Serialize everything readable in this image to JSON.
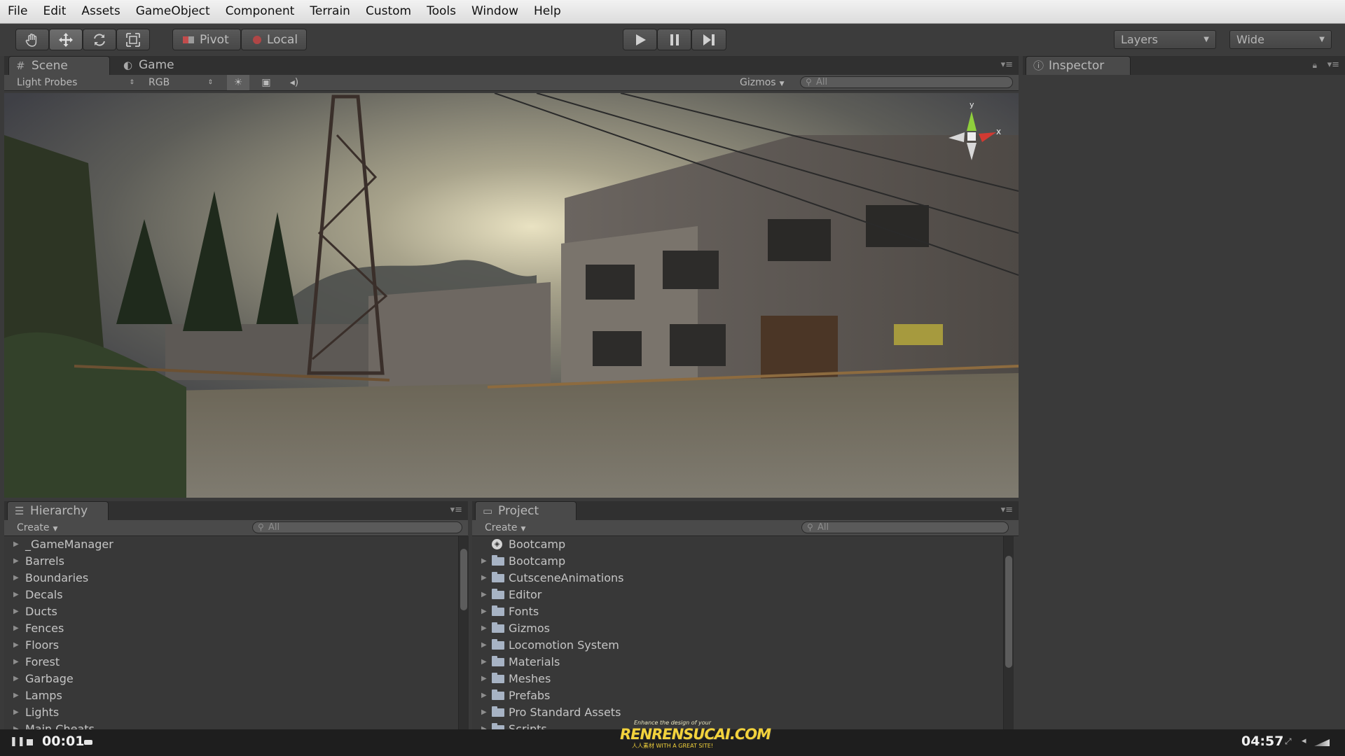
{
  "menu": [
    "File",
    "Edit",
    "Assets",
    "GameObject",
    "Component",
    "Terrain",
    "Custom",
    "Tools",
    "Window",
    "Help"
  ],
  "toolbar": {
    "tools": [
      "hand-icon",
      "move-icon",
      "rotate-icon",
      "scale-icon"
    ],
    "pivot_label": "Pivot",
    "local_label": "Local",
    "play": [
      "play-icon",
      "pause-icon",
      "step-icon"
    ],
    "layers_label": "Layers",
    "layout_label": "Wide"
  },
  "scene_tabs": {
    "scene_label": "Scene",
    "game_label": "Game"
  },
  "scene_bar": {
    "mode": "Light Probes",
    "channel": "RGB",
    "gizmos": "Gizmos",
    "search": "All"
  },
  "gizmo_axes": {
    "y": "y",
    "x": "x"
  },
  "inspector": {
    "tab_label": "Inspector"
  },
  "hierarchy": {
    "tab_label": "Hierarchy",
    "create": "Create",
    "search": "All",
    "items": [
      "_GameManager",
      "Barrels",
      "Boundaries",
      "Decals",
      "Ducts",
      "Fences",
      "Floors",
      "Forest",
      "Garbage",
      "Lamps",
      "Lights",
      "Main Cheats"
    ]
  },
  "project": {
    "tab_label": "Project",
    "create": "Create",
    "search": "All",
    "scene_item": "Bootcamp",
    "folders": [
      "Bootcamp",
      "CutsceneAnimations",
      "Editor",
      "Fonts",
      "Gizmos",
      "Locomotion System",
      "Materials",
      "Meshes",
      "Prefabs",
      "Pro Standard Assets",
      "Scripts"
    ]
  },
  "player": {
    "current": "00:01",
    "total": "04:57",
    "watermark_top": "Enhance the design of your",
    "watermark_main": "RENRENSUCAI.COM",
    "watermark_sub": "人人素材 WITH A GREAT SITE!"
  },
  "colors": {
    "accent": "#3a3a3a",
    "menubar": "#e4e4e4",
    "folder": "#a7b3c4"
  }
}
